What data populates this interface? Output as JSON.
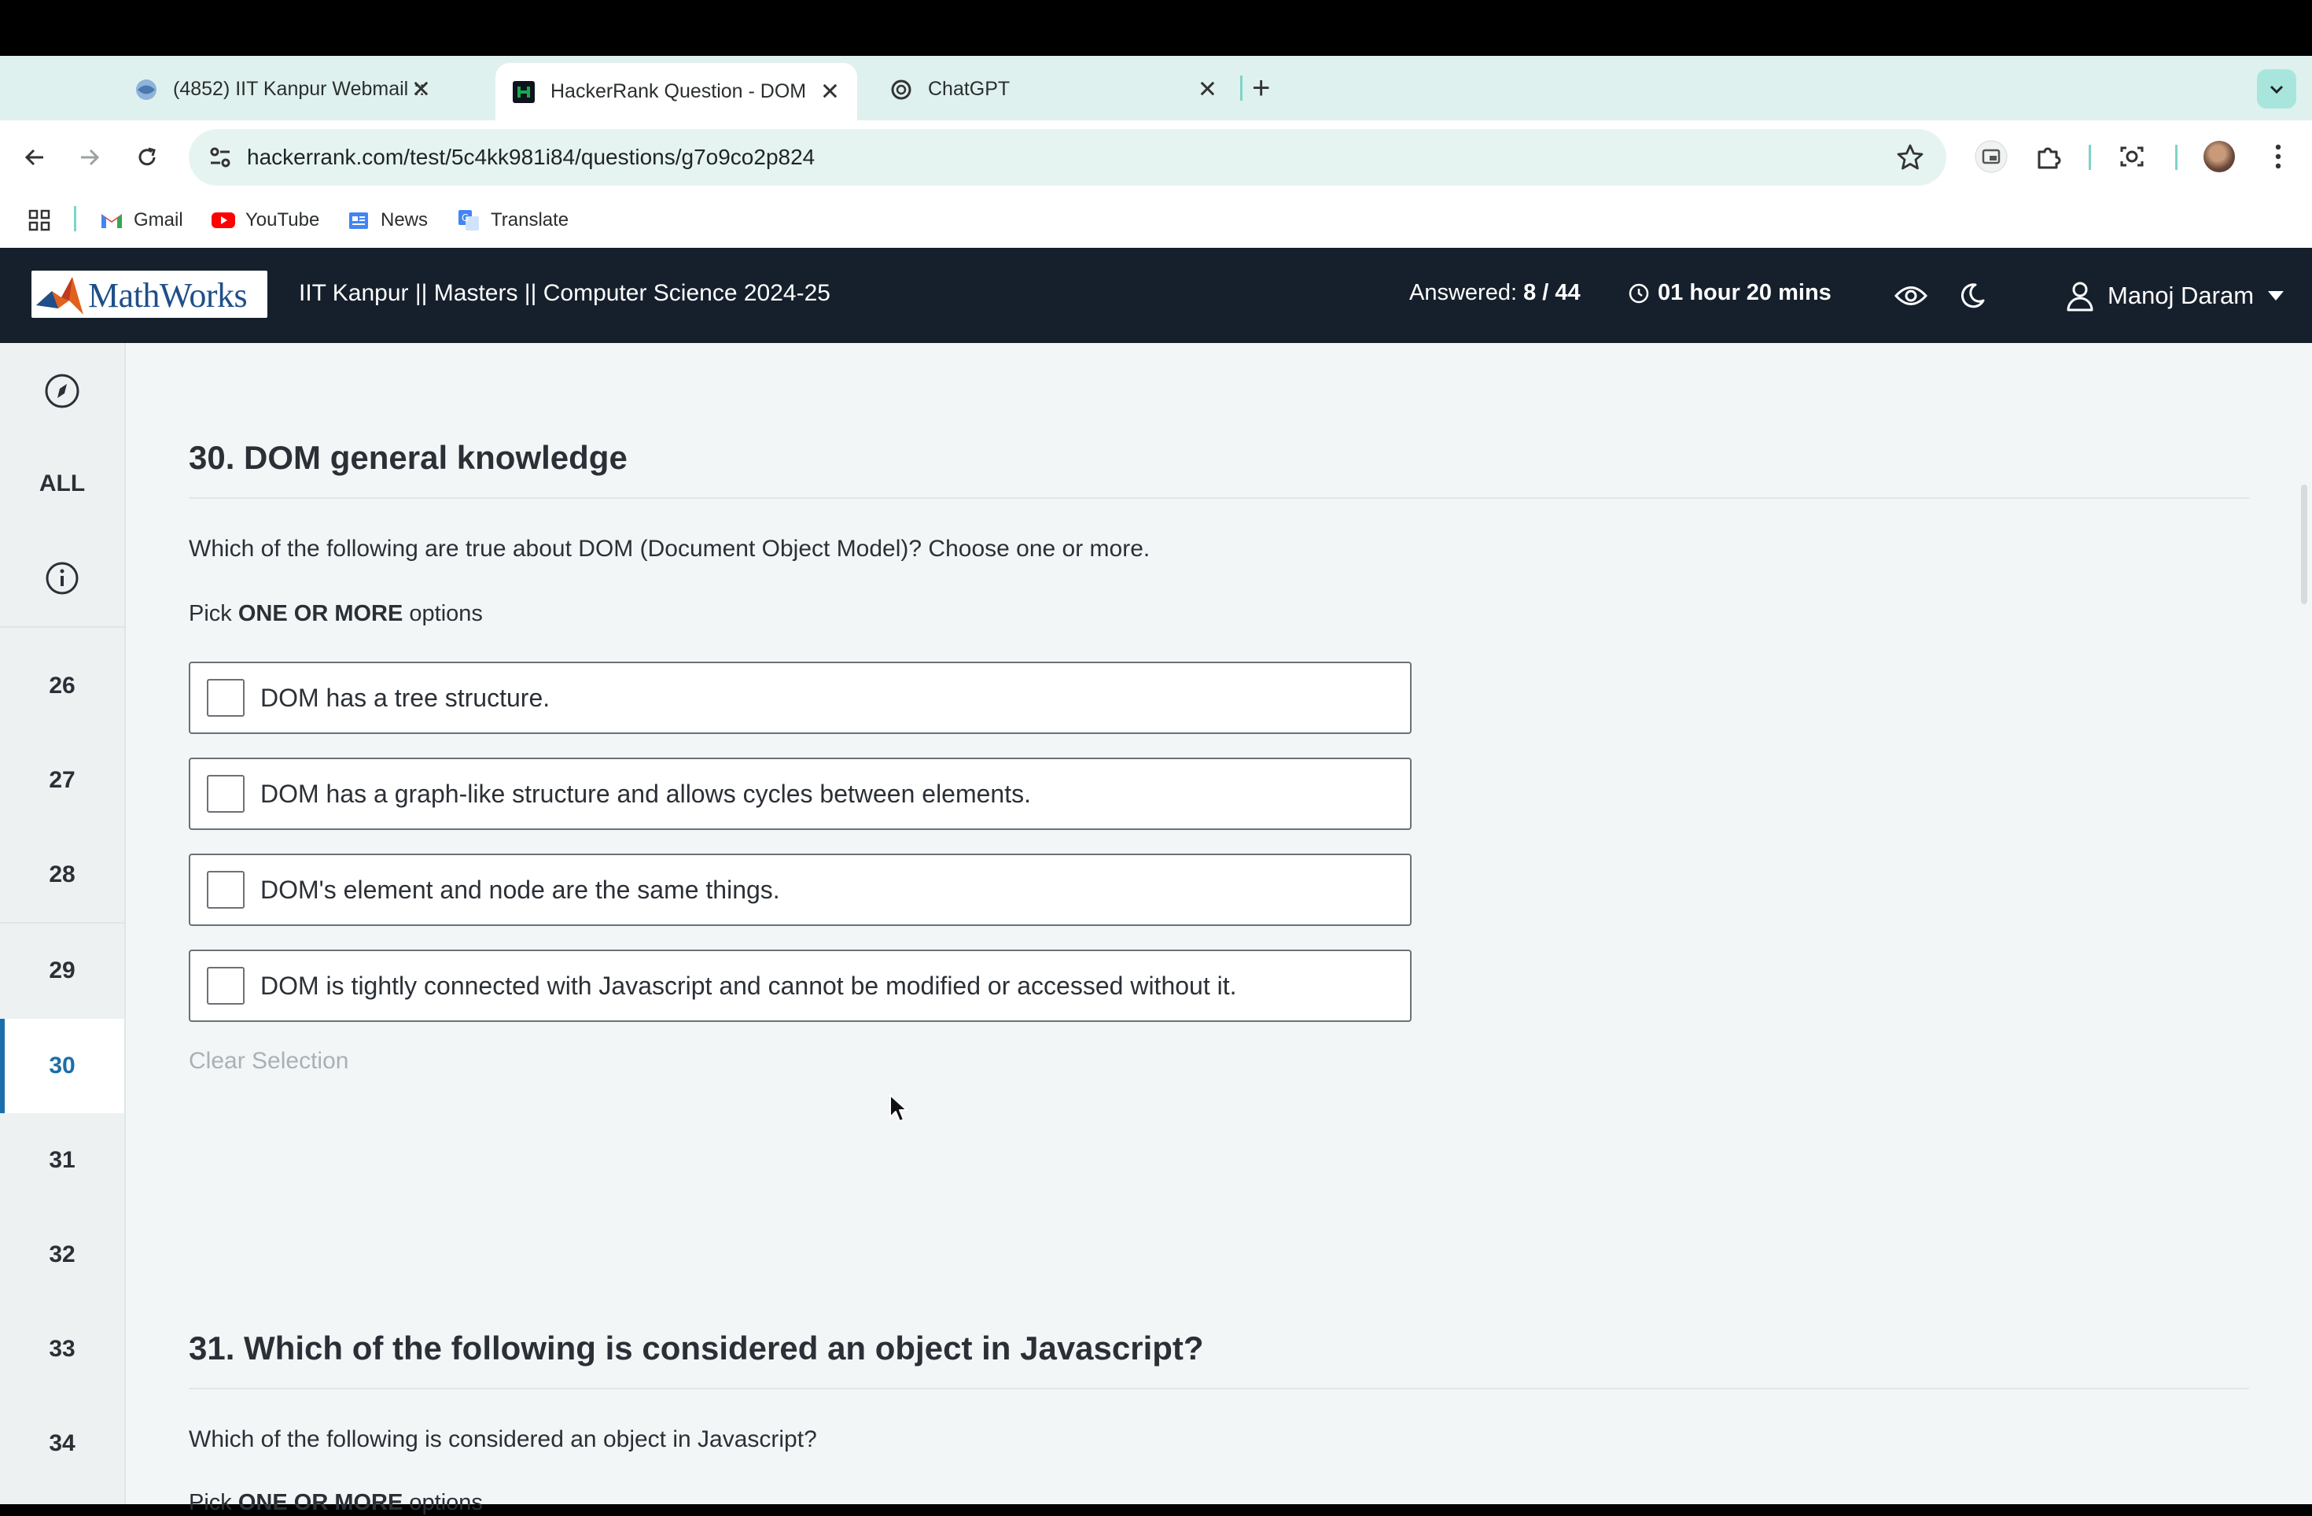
{
  "browser": {
    "tabs": [
      {
        "label": "(4852) IIT Kanpur Webmail ::",
        "icon": "webmail-favicon",
        "active": false
      },
      {
        "label": "HackerRank Question - DOM",
        "icon": "hackerrank-favicon",
        "active": true
      },
      {
        "label": "ChatGPT",
        "icon": "chatgpt-favicon",
        "active": false
      }
    ],
    "new_tab": "+",
    "close_glyph": "✕",
    "url": "hackerrank.com/test/5c4kk981i84/questions/g7o9co2p824",
    "bookmarks": [
      {
        "label": "Gmail",
        "icon": "gmail-icon"
      },
      {
        "label": "YouTube",
        "icon": "youtube-icon"
      },
      {
        "label": "News",
        "icon": "news-icon"
      },
      {
        "label": "Translate",
        "icon": "translate-icon"
      }
    ]
  },
  "header": {
    "logo_text": "MathWorks",
    "test_title": "IIT Kanpur || Masters || Computer Science 2024-25",
    "answered_label": "Answered:",
    "answered_value": "8 / 44",
    "timer": "01 hour 20 mins",
    "user_name": "Manoj Daram"
  },
  "sidebar": {
    "all_label": "ALL",
    "questions": [
      "26",
      "27",
      "28",
      "29",
      "30",
      "31",
      "32",
      "33",
      "34"
    ],
    "active_question": "30"
  },
  "questions": [
    {
      "title": "30. DOM general knowledge",
      "text": "Which of the following are true about DOM (Document Object Model)?  Choose one or more.",
      "pick_prefix": "Pick",
      "pick_bold": "ONE OR MORE",
      "pick_suffix": "options",
      "options": [
        "DOM has a tree structure.",
        "DOM has a graph-like structure and allows cycles between elements.",
        "DOM's element and node are the same things.",
        "DOM is tightly connected with Javascript and cannot be modified or accessed without it."
      ],
      "checked": [
        false,
        false,
        false,
        false
      ],
      "clear_selection": "Clear Selection"
    },
    {
      "title": "31. Which of the following is considered an object in Javascript?",
      "text": "Which of the following is considered an object in Javascript?",
      "pick_prefix": "Pick",
      "pick_bold": "ONE OR MORE",
      "pick_suffix": "options"
    }
  ],
  "colors": {
    "header_bg": "#16202c",
    "sidebar_bg": "#edf1f2",
    "main_bg": "#f3f6f7",
    "accent": "#1b6fa8",
    "tabstrip_bg": "#dff1ef"
  }
}
